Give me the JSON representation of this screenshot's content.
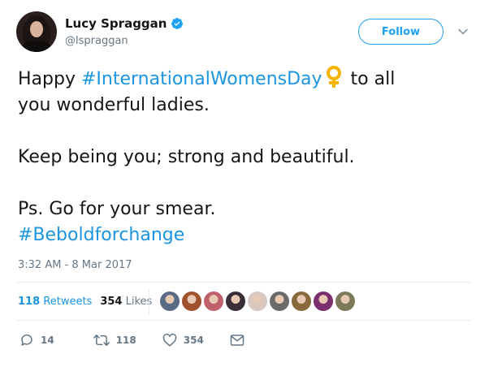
{
  "user": {
    "display_name": "Lucy Spraggan",
    "handle": "@lspraggan",
    "verified": true
  },
  "header": {
    "follow_label": "Follow",
    "menu_icon": "chevron-down-icon"
  },
  "tweet": {
    "line1_pre": "Happy ",
    "hashtag1": "#InternationalWomensDay",
    "emoji": "venus-symbol",
    "line1_post": " to all",
    "line2": "you wonderful ladies.",
    "line3": "Keep being you; strong and beautiful.",
    "line4": "Ps. Go for your smear.",
    "hashtag2": "#Beboldforchange",
    "timestamp": "3:32 AM - 8 Mar 2017"
  },
  "stats": {
    "retweets_count": "118",
    "retweets_label": "Retweets",
    "likes_count": "354",
    "likes_label": "Likes",
    "liker_avatar_colors": [
      "#5a6b86",
      "#a0522d",
      "#c0606a",
      "#3a2f38",
      "#d8c8c0",
      "#6b6b6b",
      "#8a6a3a",
      "#7a2f6e",
      "#7d7a5a"
    ]
  },
  "actions": {
    "reply_count": "14",
    "retweet_count": "118",
    "like_count": "354"
  },
  "colors": {
    "accent": "#1da1f2",
    "link": "#1b95e0",
    "muted": "#657786",
    "text": "#14171a",
    "venus": "#f5b400"
  }
}
